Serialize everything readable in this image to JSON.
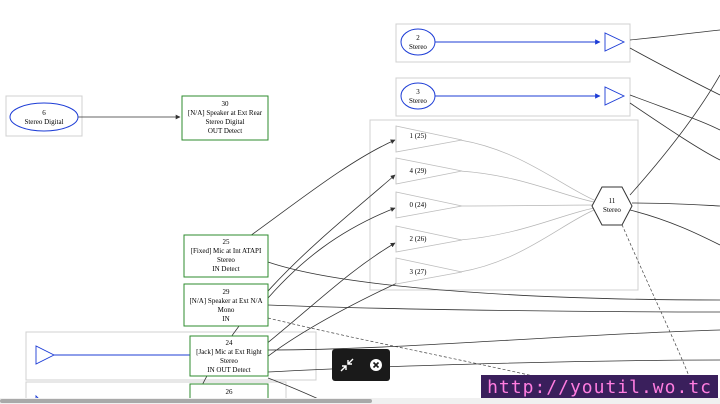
{
  "nodes": {
    "n6": [
      "6",
      "Stereo Digital"
    ],
    "n30": [
      "30",
      "[N/A] Speaker at Ext Rear",
      "Stereo Digital",
      "OUT Detect"
    ],
    "n2": [
      "2",
      "Stereo"
    ],
    "n3": [
      "3",
      "Stereo"
    ],
    "n25": [
      "25",
      "[Fixed] Mic at Int ATAPI",
      "Stereo",
      "IN Detect"
    ],
    "n29": [
      "29",
      "[N/A] Speaker at Ext N/A",
      "Mono",
      "IN"
    ],
    "n24": [
      "24",
      "[Jack] Mic at Ext Right",
      "Stereo",
      "IN OUT Detect"
    ],
    "n26": [
      "26"
    ],
    "n11": [
      "11",
      "Stereo"
    ],
    "mixer_inputs": [
      "1 (25)",
      "4 (29)",
      "0 (24)",
      "2 (26)",
      "3 (27)"
    ]
  },
  "colors": {
    "blue": "#1c3cd6",
    "green": "#2e8b2e",
    "edge": "#333333",
    "light_edge": "#b5b5b5"
  },
  "controls": {
    "zoom_fit_icon": "compress-arrows-icon",
    "close_icon": "close-circle-icon"
  },
  "watermark": "http://youtil.wo.tc"
}
